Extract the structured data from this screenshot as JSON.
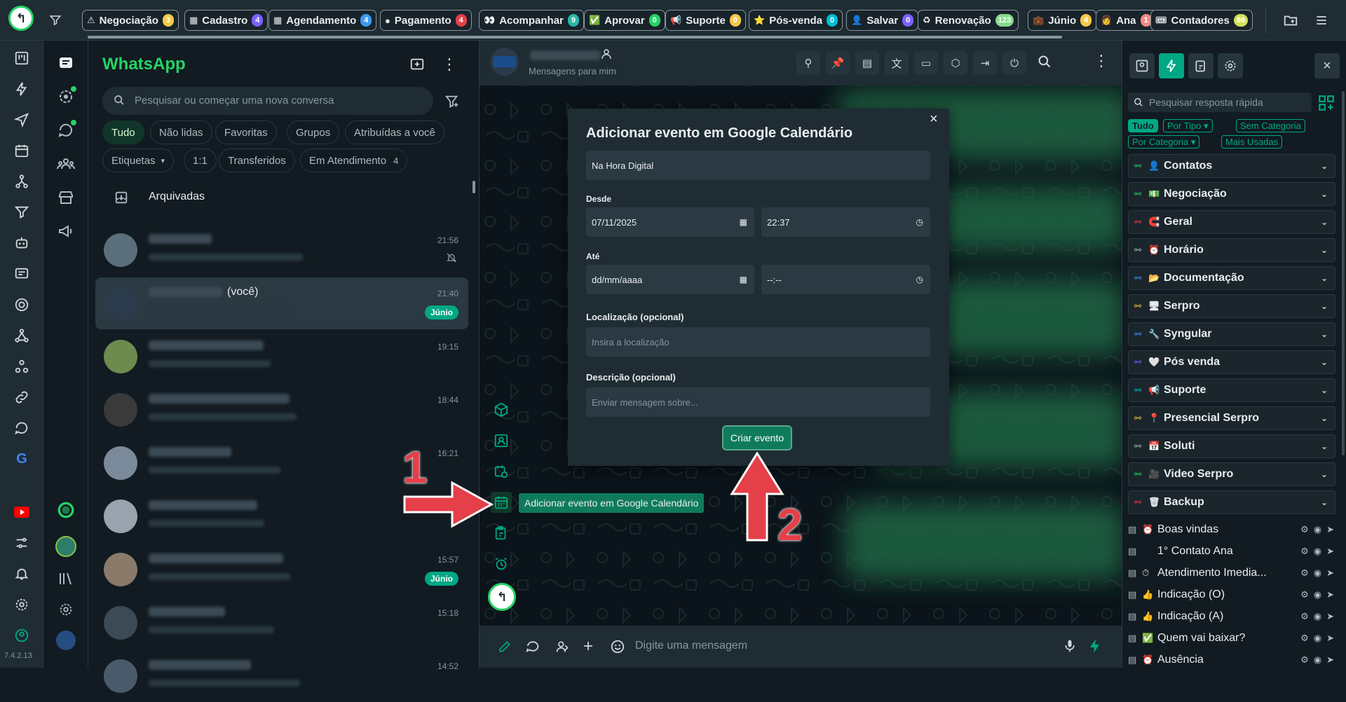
{
  "version": "7.4.2.13",
  "top_tags": [
    {
      "icon": "⚠",
      "label": "Negociação",
      "count": "3",
      "color": "#f7c948"
    },
    {
      "icon": "▦",
      "label": "Cadastro",
      "count": "4",
      "color": "#7b61ff"
    },
    {
      "icon": "▦",
      "label": "Agendamento",
      "count": "4",
      "color": "#3c9bf0"
    },
    {
      "icon": "●",
      "label": "Pagamento",
      "count": "4",
      "color": "#e53f49"
    },
    {
      "icon": "👀",
      "label": "Acompanhar",
      "count": "9",
      "color": "#2ab7a9"
    },
    {
      "icon": "✅",
      "label": "Aprovar",
      "count": "0",
      "color": "#25d366"
    },
    {
      "icon": "📢",
      "label": "Suporte",
      "count": "0",
      "color": "#f7c948"
    },
    {
      "icon": "⭐",
      "label": "Pós-venda",
      "count": "0",
      "color": "#00bcd4"
    },
    {
      "icon": "👤",
      "label": "Salvar",
      "count": "0",
      "color": "#7b61ff"
    },
    {
      "icon": "♻",
      "label": "Renovação",
      "count": "123",
      "color": "#88d98b"
    },
    {
      "icon": "💼",
      "label": "Júnio",
      "count": "4",
      "color": "#f7c948"
    },
    {
      "icon": "👩",
      "label": "Ana",
      "count": "1",
      "color": "#f28b82"
    },
    {
      "icon": "🎟",
      "label": "Contadores",
      "count": "86",
      "color": "#d4e157"
    }
  ],
  "chatlist": {
    "title": "WhatsApp",
    "search_placeholder": "Pesquisar ou começar uma nova conversa",
    "filters_row1": [
      "Tudo",
      "Não lidas",
      "Favoritas",
      "Grupos",
      "Atribuídas a você"
    ],
    "filters_row2": [
      {
        "label": "Etiquetas",
        "suffix": "▾"
      },
      {
        "label": "1:1",
        "suffix": ""
      },
      {
        "label": "Transferidos",
        "suffix": ""
      },
      {
        "label": "Em Atendimento",
        "suffix": "4"
      }
    ],
    "archived_label": "Arquivadas",
    "chats": [
      {
        "name": "",
        "time": "21:56",
        "badge": "",
        "muted": true
      },
      {
        "name": "(você)",
        "time": "21:40",
        "badge": "Júnio",
        "muted": false
      },
      {
        "name": "",
        "time": "19:15",
        "badge": "",
        "muted": false
      },
      {
        "name": "",
        "time": "18:44",
        "badge": "",
        "muted": false
      },
      {
        "name": "",
        "time": "16:21",
        "badge": "",
        "muted": false
      },
      {
        "name": "",
        "time": "",
        "badge": "",
        "muted": false
      },
      {
        "name": "",
        "time": "15:57",
        "badge": "Júnio",
        "muted": false
      },
      {
        "name": "",
        "time": "15:18",
        "badge": "",
        "muted": false
      },
      {
        "name": "",
        "time": "14:52",
        "badge": "",
        "muted": false
      }
    ]
  },
  "chat": {
    "subtitle": "Mensagens para mim",
    "composer_placeholder": "Digite uma mensagem",
    "tooltip": "Adicionar evento em Google Calendário"
  },
  "modal": {
    "title": "Adicionar evento em Google Calendário",
    "event_title_value": "Na Hora Digital",
    "label_from": "Desde",
    "from_date": "07/11/2025",
    "from_time": "22:37",
    "label_to": "Até",
    "to_date_placeholder": "dd/mm/aaaa",
    "to_time_placeholder": "--:--",
    "label_location": "Localização (opcional)",
    "location_placeholder": "Insira a localização",
    "label_description": "Descrição (opcional)",
    "description_placeholder": "Enviar mensagem sobre...",
    "submit_label": "Criar evento"
  },
  "annotations": {
    "one": "1",
    "two": "2"
  },
  "quick": {
    "search_placeholder": "Pesquisar resposta rápida",
    "filters": [
      "Tudo",
      "Por Tipo ▾",
      "Sem Categoria",
      "Por Categoria ▾",
      "Mais Usadas"
    ],
    "categories": [
      {
        "emoji": "👤",
        "label": "Contatos",
        "color": "#25d366"
      },
      {
        "emoji": "💵",
        "label": "Negociação",
        "color": "#25d366"
      },
      {
        "emoji": "🧲",
        "label": "Geral",
        "color": "#e53f49"
      },
      {
        "emoji": "⏰",
        "label": "Horário",
        "color": "#aebac1"
      },
      {
        "emoji": "📂",
        "label": "Documentação",
        "color": "#3c9bf0"
      },
      {
        "emoji": "🖥",
        "label": "Serpro",
        "color": "#f7c948"
      },
      {
        "emoji": "🔧",
        "label": "Syngular",
        "color": "#3c9bf0"
      },
      {
        "emoji": "🤍",
        "label": "Pós venda",
        "color": "#7b61ff"
      },
      {
        "emoji": "📢",
        "label": "Suporte",
        "color": "#00bcd4"
      },
      {
        "emoji": "📍",
        "label": "Presencial Serpro",
        "color": "#f7c948"
      },
      {
        "emoji": "📅",
        "label": "Soluti",
        "color": "#aebac1"
      },
      {
        "emoji": "🎥",
        "label": "Video Serpro",
        "color": "#25d366"
      },
      {
        "emoji": "🗑",
        "label": "Backup",
        "color": "#e53f49"
      }
    ],
    "replies": [
      {
        "emoji": "⏰",
        "label": "Boas vindas"
      },
      {
        "emoji": "",
        "label": "1° Contato Ana"
      },
      {
        "emoji": "⏱",
        "label": "Atendimento Imedia..."
      },
      {
        "emoji": "👍",
        "label": "Indicação (O)"
      },
      {
        "emoji": "👍",
        "label": "Indicação (A)"
      },
      {
        "emoji": "✅",
        "label": "Quem vai baixar?"
      },
      {
        "emoji": "⏰",
        "label": "Ausência"
      }
    ]
  }
}
